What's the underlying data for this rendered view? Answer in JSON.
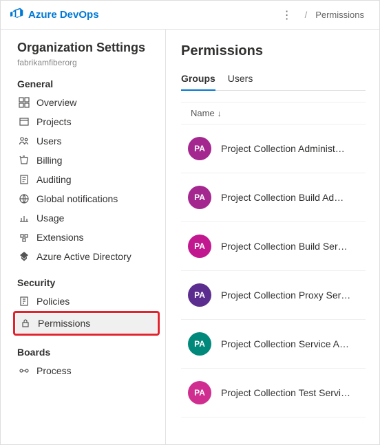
{
  "brand": "Azure DevOps",
  "breadcrumb": {
    "more": "⋮",
    "sep": "/",
    "current": "Permissions"
  },
  "sidebar": {
    "title": "Organization Settings",
    "org": "fabrikamfiberorg",
    "sections": {
      "general": {
        "title": "General",
        "items": [
          {
            "label": "Overview"
          },
          {
            "label": "Projects"
          },
          {
            "label": "Users"
          },
          {
            "label": "Billing"
          },
          {
            "label": "Auditing"
          },
          {
            "label": "Global notifications"
          },
          {
            "label": "Usage"
          },
          {
            "label": "Extensions"
          },
          {
            "label": "Azure Active Directory"
          }
        ]
      },
      "security": {
        "title": "Security",
        "items": [
          {
            "label": "Policies"
          },
          {
            "label": "Permissions"
          }
        ]
      },
      "boards": {
        "title": "Boards",
        "items": [
          {
            "label": "Process"
          }
        ]
      }
    }
  },
  "main": {
    "title": "Permissions",
    "tabs": [
      {
        "label": "Groups"
      },
      {
        "label": "Users"
      }
    ],
    "columnHeader": "Name",
    "groups": [
      {
        "initials": "PA",
        "color": "#a4268f",
        "label": "Project Collection Administ…"
      },
      {
        "initials": "PA",
        "color": "#a4268f",
        "label": "Project Collection Build Ad…"
      },
      {
        "initials": "PA",
        "color": "#c2188f",
        "label": "Project Collection Build Ser…"
      },
      {
        "initials": "PA",
        "color": "#5b2d8f",
        "label": "Project Collection Proxy Ser…"
      },
      {
        "initials": "PA",
        "color": "#00897b",
        "label": "Project Collection Service A…"
      },
      {
        "initials": "PA",
        "color": "#cf2d8f",
        "label": "Project Collection Test Servi…"
      }
    ]
  }
}
